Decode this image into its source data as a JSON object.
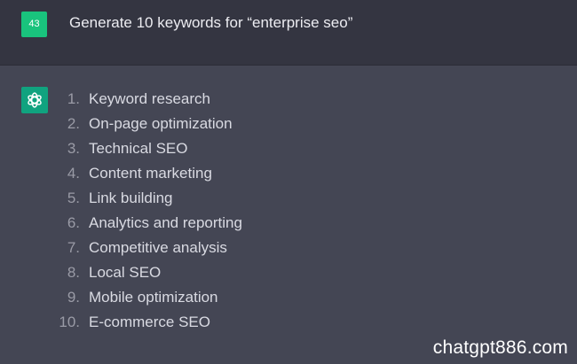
{
  "user": {
    "avatar_text": "43",
    "message": "Generate 10 keywords for “enterprise seo”"
  },
  "assistant": {
    "avatar_icon": "openai-logo-icon",
    "items": [
      {
        "num": "1.",
        "text": "Keyword research"
      },
      {
        "num": "2.",
        "text": "On-page optimization"
      },
      {
        "num": "3.",
        "text": "Technical SEO"
      },
      {
        "num": "4.",
        "text": "Content marketing"
      },
      {
        "num": "5.",
        "text": "Link building"
      },
      {
        "num": "6.",
        "text": "Analytics and reporting"
      },
      {
        "num": "7.",
        "text": "Competitive analysis"
      },
      {
        "num": "8.",
        "text": "Local SEO"
      },
      {
        "num": "9.",
        "text": "Mobile optimization"
      },
      {
        "num": "10.",
        "text": "E-commerce SEO"
      }
    ]
  },
  "watermark": "chatgpt886.com",
  "colors": {
    "user_bg": "#343541",
    "assistant_bg": "#444654",
    "user_avatar": "#19c37d",
    "gpt_avatar": "#10a37f"
  }
}
